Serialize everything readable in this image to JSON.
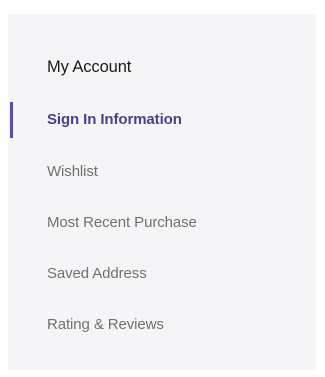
{
  "account_menu": {
    "title": "My Account",
    "items": [
      {
        "label": "Sign In Information",
        "active": true
      },
      {
        "label": "Wishlist",
        "active": false
      },
      {
        "label": "Most Recent Purchase",
        "active": false
      },
      {
        "label": "Saved Address",
        "active": false
      },
      {
        "label": "Rating & Reviews",
        "active": false
      }
    ]
  },
  "colors": {
    "panel_background": "#f5f5f7",
    "active_text": "#4b4090",
    "active_indicator": "#5a4ea0",
    "inactive_text": "#707070",
    "title_text": "#1a1a1a"
  }
}
